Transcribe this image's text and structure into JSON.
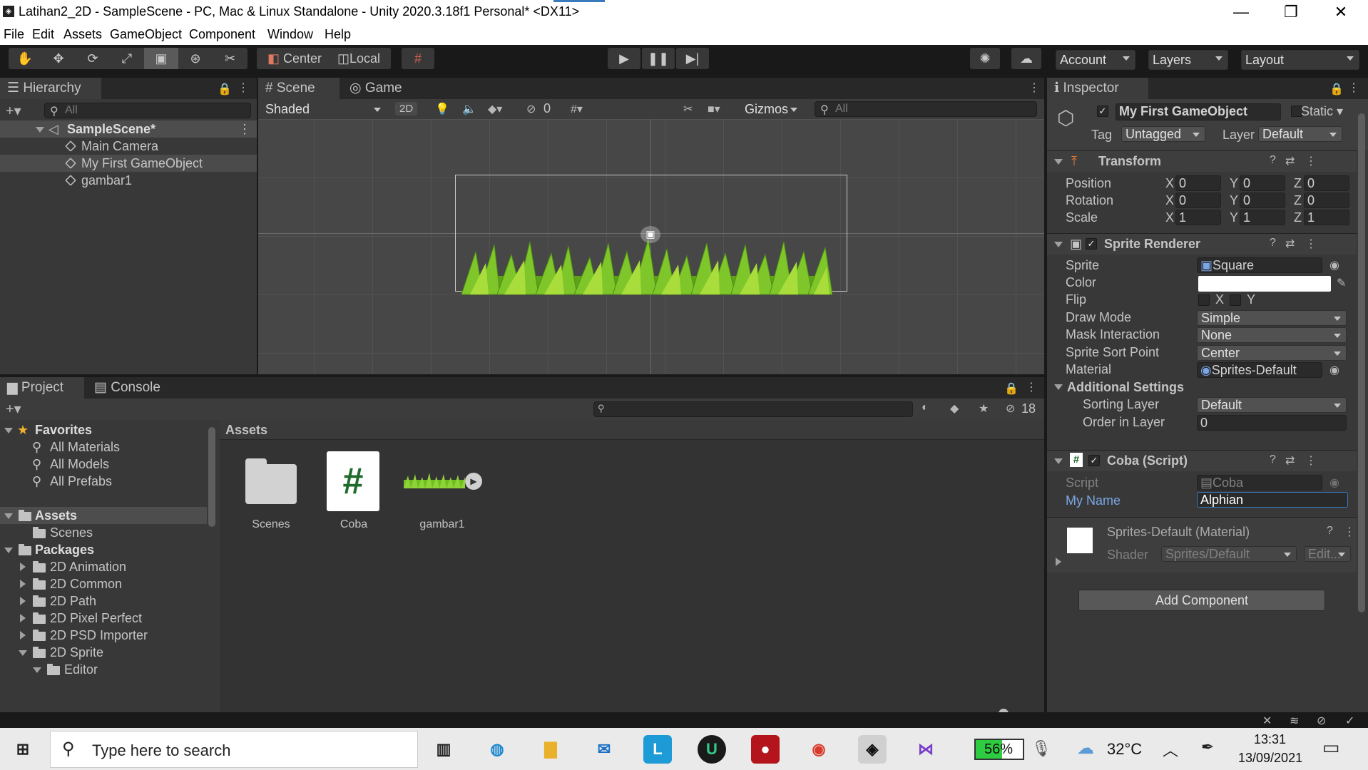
{
  "window": {
    "title": "Latihan2_2D - SampleScene - PC, Mac & Linux Standalone - Unity 2020.3.18f1 Personal* <DX11>",
    "minimize": "—",
    "maximize": "❐",
    "close": "✕"
  },
  "menu": [
    "File",
    "Edit",
    "Assets",
    "GameObject",
    "Component",
    "Window",
    "Help"
  ],
  "toolbar": {
    "center": "Center",
    "local": "Local",
    "account": "Account",
    "layers": "Layers",
    "layout": "Layout"
  },
  "hierarchy": {
    "tab": "Hierarchy",
    "search": "All",
    "scene": "SampleScene*",
    "items": [
      "Main Camera",
      "My First GameObject",
      "gambar1"
    ]
  },
  "scene": {
    "tab_scene": "Scene",
    "tab_game": "Game",
    "shading": "Shaded",
    "mode2d": "2D",
    "hidden_count": "0",
    "gizmos": "Gizmos",
    "search": "All"
  },
  "project": {
    "tab_project": "Project",
    "tab_console": "Console",
    "hidden_count": "18",
    "breadcrumb": "Assets",
    "favorites": "Favorites",
    "fav_items": [
      "All Materials",
      "All Models",
      "All Prefabs"
    ],
    "assets_label": "Assets",
    "assets_children": [
      "Scenes"
    ],
    "packages_label": "Packages",
    "packages": [
      "2D Animation",
      "2D Common",
      "2D Path",
      "2D Pixel Perfect",
      "2D PSD Importer",
      "2D Sprite"
    ],
    "sprite_child": "Editor",
    "files": [
      "Scenes",
      "Coba",
      "gambar1"
    ]
  },
  "inspector": {
    "tab": "Inspector",
    "object_name": "My First GameObject",
    "static": "Static",
    "tag_label": "Tag",
    "tag": "Untagged",
    "layer_label": "Layer",
    "layer": "Default",
    "transform": {
      "title": "Transform",
      "rows": [
        {
          "label": "Position",
          "x": "0",
          "y": "0",
          "z": "0"
        },
        {
          "label": "Rotation",
          "x": "0",
          "y": "0",
          "z": "0"
        },
        {
          "label": "Scale",
          "x": "1",
          "y": "1",
          "z": "1"
        }
      ]
    },
    "sprite_renderer": {
      "title": "Sprite Renderer",
      "sprite_label": "Sprite",
      "sprite": "Square",
      "color_label": "Color",
      "color": "#ffffff",
      "flip_label": "Flip",
      "flip_x": "X",
      "flip_y": "Y",
      "draw_mode_label": "Draw Mode",
      "draw_mode": "Simple",
      "mask_label": "Mask Interaction",
      "mask": "None",
      "sort_point_label": "Sprite Sort Point",
      "sort_point": "Center",
      "material_label": "Material",
      "material": "Sprites-Default",
      "additional": "Additional Settings",
      "sorting_layer_label": "Sorting Layer",
      "sorting_layer": "Default",
      "order_label": "Order in Layer",
      "order": "0"
    },
    "script": {
      "title": "Coba (Script)",
      "script_label": "Script",
      "script": "Coba",
      "my_name_label": "My Name",
      "my_name": "Alphian"
    },
    "material": {
      "title": "Sprites-Default (Material)",
      "shader_label": "Shader",
      "shader": "Sprites/Default",
      "edit": "Edit..."
    },
    "add_component": "Add Component"
  },
  "taskbar": {
    "search_placeholder": "Type here to search",
    "battery": "56%",
    "temperature": "32°C",
    "time": "13:31",
    "date": "13/09/2021"
  },
  "colors": {
    "accent": "#3a79bb",
    "selection": "#4d4d4d",
    "grass": "#6fbf1f",
    "link_field": "#7aa6e6"
  }
}
